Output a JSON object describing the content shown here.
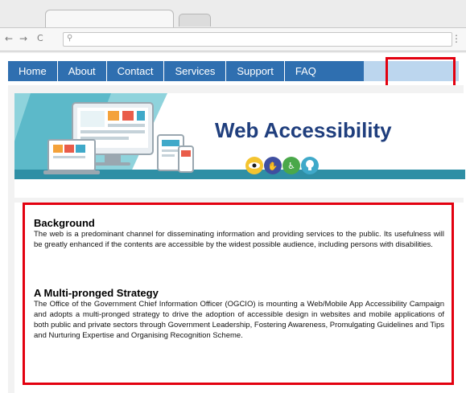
{
  "browser": {
    "back_icon": "←",
    "forward_icon": "→",
    "reload_icon": "C",
    "search_icon": "⚲",
    "menu_icon": "⋮"
  },
  "nav": {
    "items": [
      "Home",
      "About",
      "Contact",
      "Services",
      "Support",
      "FAQ"
    ]
  },
  "banner": {
    "title": "Web Accessibility"
  },
  "sections": [
    {
      "heading": "Background",
      "text": "The web is a predominant channel for disseminating information and providing services to the public. Its usefulness will be greatly enhanced if the contents are accessible by the widest possible audience, including persons with disabilities."
    },
    {
      "heading": "A Multi-pronged Strategy",
      "text": "The Office of the Government Chief Information Officer (OGCIO) is mounting a Web/Mobile App Accessibility Campaign and adopts a multi-pronged strategy to drive the adoption of accessible design in websites and mobile applications of both public and private sectors through Government Leadership, Fostering Awareness, Promulgating Guidelines and Tips and Nurturing Expertise and Organising Recognition Scheme."
    }
  ],
  "colors": {
    "nav_bg": "#2f6fb0",
    "highlight": "#e3000f",
    "title": "#1f3e7d",
    "teal": "#2f8fa5"
  }
}
